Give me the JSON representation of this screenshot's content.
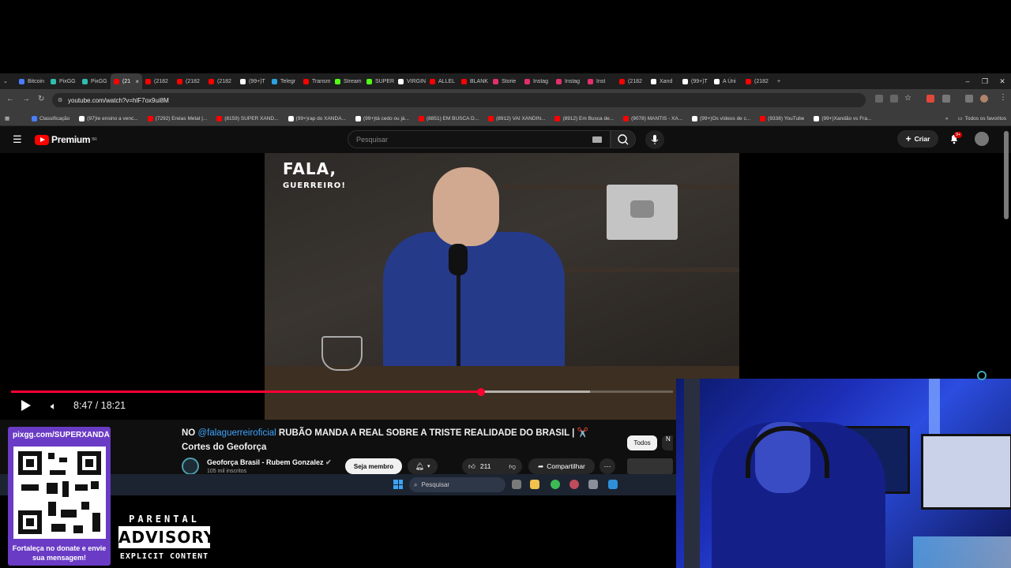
{
  "browser": {
    "tabs": [
      {
        "label": "Bitcoin",
        "color": "#4a7cff"
      },
      {
        "label": "PixGG",
        "color": "#32bcad"
      },
      {
        "label": "PixGG",
        "color": "#32bcad"
      },
      {
        "label": "(21",
        "color": "#ff0000",
        "active": true
      },
      {
        "label": "(2182",
        "color": "#ff0000"
      },
      {
        "label": "(2182",
        "color": "#ff0000"
      },
      {
        "label": "(2182",
        "color": "#ff0000"
      },
      {
        "label": "(99+)T",
        "color": "#ffffff"
      },
      {
        "label": "Telegr",
        "color": "#2aa3e0"
      },
      {
        "label": "Transm",
        "color": "#ff0000"
      },
      {
        "label": "Stream",
        "color": "#53fc18"
      },
      {
        "label": "SUPER",
        "color": "#53fc18"
      },
      {
        "label": "VIRGIN",
        "color": "#ffffff"
      },
      {
        "label": "ALLEL",
        "color": "#ff0000"
      },
      {
        "label": "BLANK",
        "color": "#ff0000"
      },
      {
        "label": "Storie",
        "color": "#e1306c"
      },
      {
        "label": "Instag",
        "color": "#e1306c"
      },
      {
        "label": "Instag",
        "color": "#e1306c"
      },
      {
        "label": "Inst",
        "color": "#e1306c"
      },
      {
        "label": "(2182",
        "color": "#ff0000"
      },
      {
        "label": "Xand",
        "color": "#ffffff"
      },
      {
        "label": "(99+)T",
        "color": "#ffffff"
      },
      {
        "label": "A Úni",
        "color": "#ffffff"
      },
      {
        "label": "(2182",
        "color": "#ff0000"
      }
    ],
    "new_tab": "+",
    "window_controls": {
      "minimize": "–",
      "maximize": "❐",
      "close": "✕"
    },
    "url": "youtube.com/watch?v=hlF7ox9ui8M",
    "bookmarks": [
      {
        "label": "Classificação",
        "color": "#4a7cff"
      },
      {
        "label": "(97)Ie ensino a venc...",
        "color": "#ffffff"
      },
      {
        "label": "(7292) Enéas Metal |...",
        "color": "#ff0000"
      },
      {
        "label": "(8159) SUPER XAND...",
        "color": "#ff0000"
      },
      {
        "label": "(99+)rap do XANDÃ...",
        "color": "#ffffff"
      },
      {
        "label": "(99+)tá cedo ou já...",
        "color": "#ffffff"
      },
      {
        "label": "(8851) EM BUSCA D...",
        "color": "#ff0000"
      },
      {
        "label": "(8912) VAI XANDIN...",
        "color": "#ff0000"
      },
      {
        "label": "(8912) Em Busca de...",
        "color": "#ff0000"
      },
      {
        "label": "(9078) MANTIS - XA...",
        "color": "#ff0000"
      },
      {
        "label": "(99+)Os vídeos de c...",
        "color": "#ffffff"
      },
      {
        "label": "(9338) YouTube",
        "color": "#ff0000"
      },
      {
        "label": "(99+)Xandão vs Fra...",
        "color": "#ffffff"
      }
    ],
    "all_bookmarks": "Todos os favoritos"
  },
  "youtube": {
    "logo_text": "Premium",
    "logo_region": "BR",
    "search_placeholder": "Pesquisar",
    "create_label": "Criar",
    "notif_badge": "9+",
    "video_brand_line1": "FALA,",
    "video_brand_line2": "GUERREIRO!",
    "time_display": "8:47 / 18:21",
    "progress": 0.71,
    "buffered": 0.875,
    "title_prefix": "NO ",
    "title_mention": "@falaguerreiroficial",
    "title_rest": " RUBÃO MANDA A REAL SOBRE A TRISTE REALIDADE DO BRASIL | ✂️ Cortes do Geoforça",
    "channel_name": "Geoforça Brasil - Rubem Gonzalez",
    "channel_subs": "105 mil inscritos",
    "join_label": "Seja membro",
    "like_count": "211",
    "share_label": "Compartilhar",
    "chip_all": "Todos",
    "chip_next": "N"
  },
  "taskbar": {
    "search_placeholder": "Pesquisar"
  },
  "overlay": {
    "donate_url": "pixgg.com/SUPERXANDÃ",
    "donate_message": "Fortaleça no donate e envie sua mensagem!",
    "advisory_top": "PARENTAL",
    "advisory_mid": "ADVISORY",
    "advisory_bottom": "EXPLICIT CONTENT"
  }
}
